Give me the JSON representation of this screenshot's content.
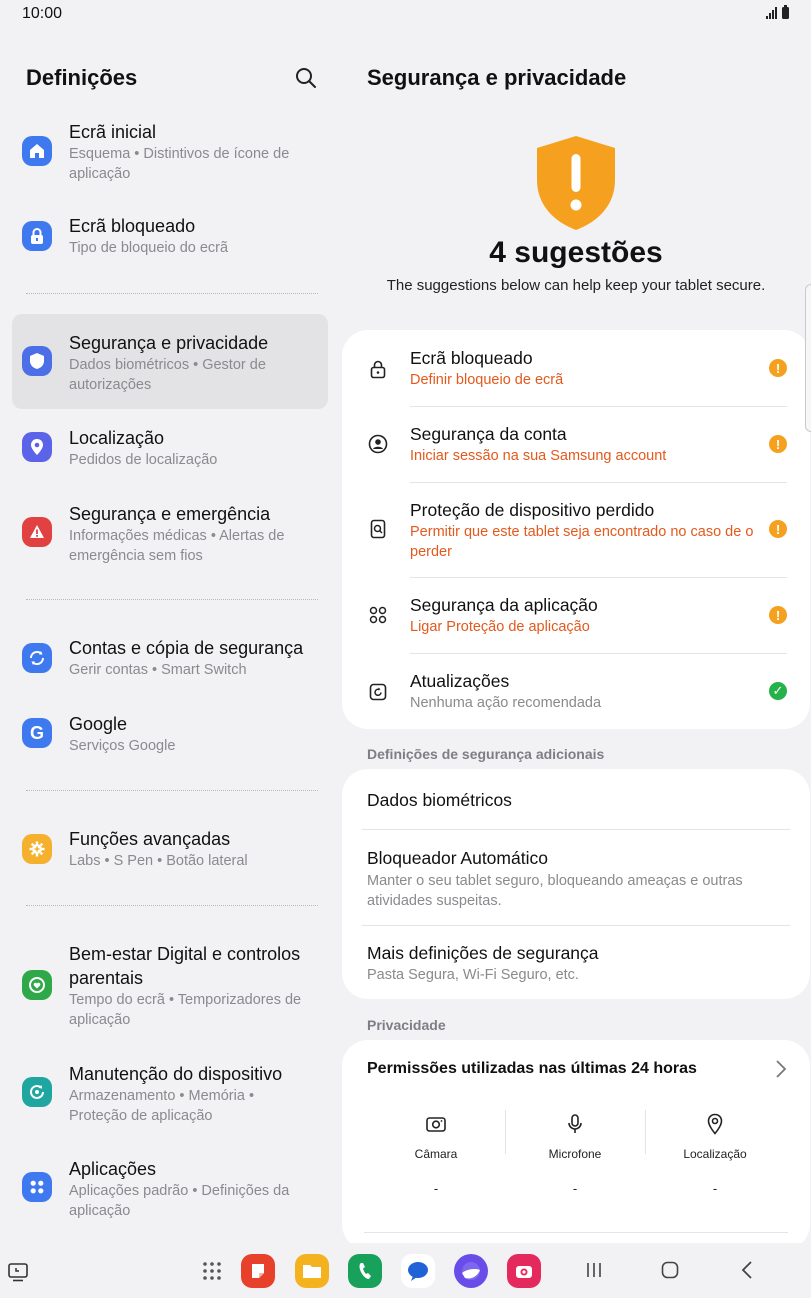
{
  "status_bar": {
    "time": "10:00"
  },
  "left": {
    "title": "Definições",
    "items": [
      {
        "title": "Ecrã inicial",
        "subtitle": "Esquema • Distintivos de ícone de aplicação"
      },
      {
        "title": "Ecrã bloqueado",
        "subtitle": "Tipo de bloqueio do ecrã"
      },
      {
        "title": "Segurança e privacidade",
        "subtitle": "Dados biométricos • Gestor de autorizações"
      },
      {
        "title": "Localização",
        "subtitle": "Pedidos de localização"
      },
      {
        "title": "Segurança e emergência",
        "subtitle": "Informações médicas • Alertas de emergência sem fios"
      },
      {
        "title": "Contas e cópia de segurança",
        "subtitle": "Gerir contas • Smart Switch"
      },
      {
        "title": "Google",
        "subtitle": "Serviços Google"
      },
      {
        "title": "Funções avançadas",
        "subtitle": "Labs • S Pen • Botão lateral"
      },
      {
        "title": "Bem-estar Digital e controlos parentais",
        "subtitle": "Tempo do ecrã • Temporizadores de aplicação"
      },
      {
        "title": "Manutenção do dispositivo",
        "subtitle": "Armazenamento • Memória • Proteção de aplicação"
      },
      {
        "title": "Aplicações",
        "subtitle": "Aplicações padrão • Definições da aplicação"
      }
    ]
  },
  "right": {
    "title": "Segurança e privacidade",
    "suggestions_count": "4 sugestões",
    "suggestions_desc": "The suggestions below can help keep your tablet secure.",
    "suggestions": [
      {
        "title": "Ecrã bloqueado",
        "subtitle": "Definir bloqueio de ecrã",
        "status": "!"
      },
      {
        "title": "Segurança da conta",
        "subtitle": "Iniciar sessão na sua Samsung account",
        "status": "!"
      },
      {
        "title": "Proteção de dispositivo perdido",
        "subtitle": "Permitir que este tablet seja encontrado no caso de o perder",
        "status": "!"
      },
      {
        "title": "Segurança da aplicação",
        "subtitle": "Ligar Proteção de aplicação",
        "status": "!"
      },
      {
        "title": "Atualizações",
        "subtitle": "Nenhuma ação recomendada",
        "status": "✓"
      }
    ],
    "additional_label": "Definições de segurança adicionais",
    "additional": [
      {
        "title": "Dados biométricos",
        "subtitle": ""
      },
      {
        "title": "Bloqueador Automático",
        "subtitle": "Manter o seu tablet seguro, bloqueando ameaças e outras atividades suspeitas."
      },
      {
        "title": "Mais definições de segurança",
        "subtitle": "Pasta Segura, Wi-Fi Seguro, etc."
      }
    ],
    "privacy_label": "Privacidade",
    "permissions": {
      "title": "Permissões utilizadas nas últimas 24 horas",
      "items": [
        {
          "label": "Câmara",
          "value": "-"
        },
        {
          "label": "Microfone",
          "value": "-"
        },
        {
          "label": "Localização",
          "value": "-"
        }
      ]
    }
  },
  "colors": {
    "accent_blue": "#3f79f0",
    "warning_orange": "#f5a11f",
    "warning_text": "#e4591c",
    "ok_green": "#25b24a"
  }
}
